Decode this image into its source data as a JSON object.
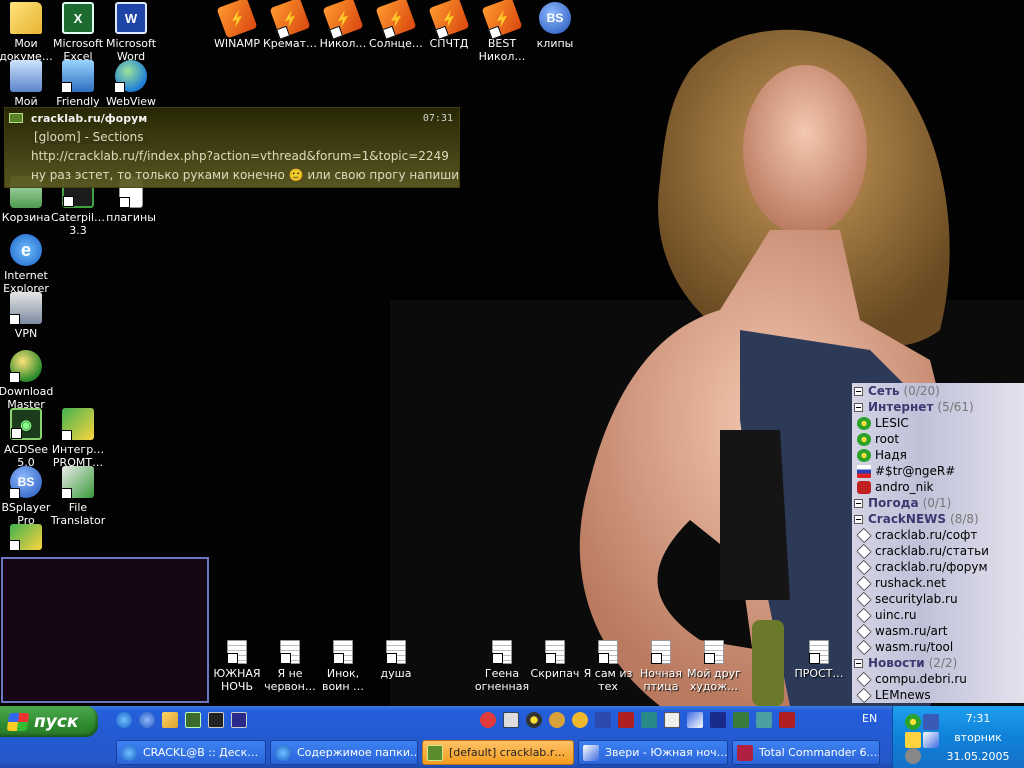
{
  "desktop": {
    "icons": [
      {
        "label": "Мои\nдокуме…",
        "icon": "my-documents-folder-icon"
      },
      {
        "label": "Microsoft\nExcel",
        "icon": "excel-icon"
      },
      {
        "label": "Microsoft\nWord",
        "icon": "word-icon"
      },
      {
        "label": "WINAMP",
        "icon": "winamp-icon"
      },
      {
        "label": "Кремат…",
        "icon": "winamp-icon"
      },
      {
        "label": "Никол…",
        "icon": "winamp-icon"
      },
      {
        "label": "Солнце…",
        "icon": "winamp-icon"
      },
      {
        "label": "СПЧТД",
        "icon": "winamp-icon"
      },
      {
        "label": "BEST\nНикол…",
        "icon": "winamp-icon"
      },
      {
        "label": "клипы",
        "icon": "bsplayer-icon"
      },
      {
        "label": "Мой",
        "icon": "my-computer-icon"
      },
      {
        "label": "Friendly",
        "icon": "network-computers-icon"
      },
      {
        "label": "WebView",
        "icon": "webview-globe-icon"
      },
      {
        "label": "Корзина",
        "icon": "recycle-bin-icon"
      },
      {
        "label": "Caterpil…\n3.3",
        "icon": "caterpillar-icon"
      },
      {
        "label": "плагины",
        "icon": "plugins-icon"
      },
      {
        "label": "Internet\nExplorer",
        "icon": "internet-explorer-icon"
      },
      {
        "label": "VPN",
        "icon": "vpn-icon"
      },
      {
        "label": "Download\nMaster",
        "icon": "download-master-icon"
      },
      {
        "label": "ACDSee\n5.0",
        "icon": "acdsee-icon"
      },
      {
        "label": "Интегр…\nPROMT…",
        "icon": "promt-icon"
      },
      {
        "label": "BSplayer\nPro",
        "icon": "bsplayer-icon"
      },
      {
        "label": "File\nTranslator",
        "icon": "file-translator-icon"
      },
      {
        "label": "",
        "icon": "app-shortcut-icon"
      }
    ],
    "text_files": [
      {
        "label": "ЮЖНАЯ\nНОЧЬ"
      },
      {
        "label": "Я не\nчервон…"
      },
      {
        "label": "Инок,\nвоин …"
      },
      {
        "label": "душа"
      },
      {
        "label": "Геена\nогненная"
      },
      {
        "label": "Скрипач"
      },
      {
        "label": "Я сам из\nтех"
      },
      {
        "label": "Ночная\nптица"
      },
      {
        "label": "Мой друг\nхудож…"
      },
      {
        "label": "ПРОСТ…"
      }
    ]
  },
  "popup": {
    "title": "cracklab.ru/форум",
    "time": "07:31",
    "line1": "[gloom] - Sections",
    "line2": "http://cracklab.ru/f/index.php?action=vthread&forum=1&topic=2249",
    "line3": "ну раз эстет, то только руками конечно 🙂 или свою прогу напиши ;)…"
  },
  "contact_list": {
    "rows": [
      {
        "type": "group",
        "name": "Сеть",
        "count": "(0/20)"
      },
      {
        "type": "group",
        "name": "Интернет",
        "count": "(5/61)"
      },
      {
        "type": "contact",
        "name": "LESIC",
        "icon": "flower"
      },
      {
        "type": "contact",
        "name": "root",
        "icon": "flower"
      },
      {
        "type": "contact",
        "name": "Надя",
        "icon": "flower"
      },
      {
        "type": "contact",
        "name": "#$tr@ngeR#",
        "icon": "flag"
      },
      {
        "type": "contact",
        "name": "andro_nik",
        "icon": "na"
      },
      {
        "type": "group",
        "name": "Погода",
        "count": "(0/1)"
      },
      {
        "type": "group",
        "name": "CrackNEWS",
        "count": "(8/8)"
      },
      {
        "type": "contact",
        "name": "cracklab.ru/софт",
        "icon": "rss"
      },
      {
        "type": "contact",
        "name": "cracklab.ru/статьи",
        "icon": "rss"
      },
      {
        "type": "contact",
        "name": "cracklab.ru/форум",
        "icon": "rss"
      },
      {
        "type": "contact",
        "name": "rushack.net",
        "icon": "rss"
      },
      {
        "type": "contact",
        "name": "securitylab.ru",
        "icon": "rss"
      },
      {
        "type": "contact",
        "name": "uinc.ru",
        "icon": "rss"
      },
      {
        "type": "contact",
        "name": "wasm.ru/art",
        "icon": "rss"
      },
      {
        "type": "contact",
        "name": "wasm.ru/tool",
        "icon": "rss"
      },
      {
        "type": "group",
        "name": "Новости",
        "count": "(2/2)"
      },
      {
        "type": "contact",
        "name": "compu.debri.ru",
        "icon": "rss"
      },
      {
        "type": "contact",
        "name": "LEMnews",
        "icon": "rss"
      }
    ]
  },
  "taskbar": {
    "start_label": "пуск",
    "language": "EN",
    "buttons": [
      {
        "label": "CRACKL@B :: Деск…",
        "active": false
      },
      {
        "label": "Содержимое папки…",
        "active": false
      },
      {
        "label": "[default] cracklab.r…",
        "active": true
      },
      {
        "label": "Звери - Южная ноч…",
        "active": false
      },
      {
        "label": "Total Commander 6.…",
        "active": false
      }
    ],
    "clock": {
      "time": "7:31",
      "day": "вторник",
      "date": "31.05.2005"
    }
  },
  "colors": {
    "taskbar_blue": "#245edb",
    "start_green": "#2e8b2e",
    "active_task_orange": "#f49c1e",
    "popup_olive": "#5c5a22",
    "clist_group_text": "#3a3a70"
  }
}
